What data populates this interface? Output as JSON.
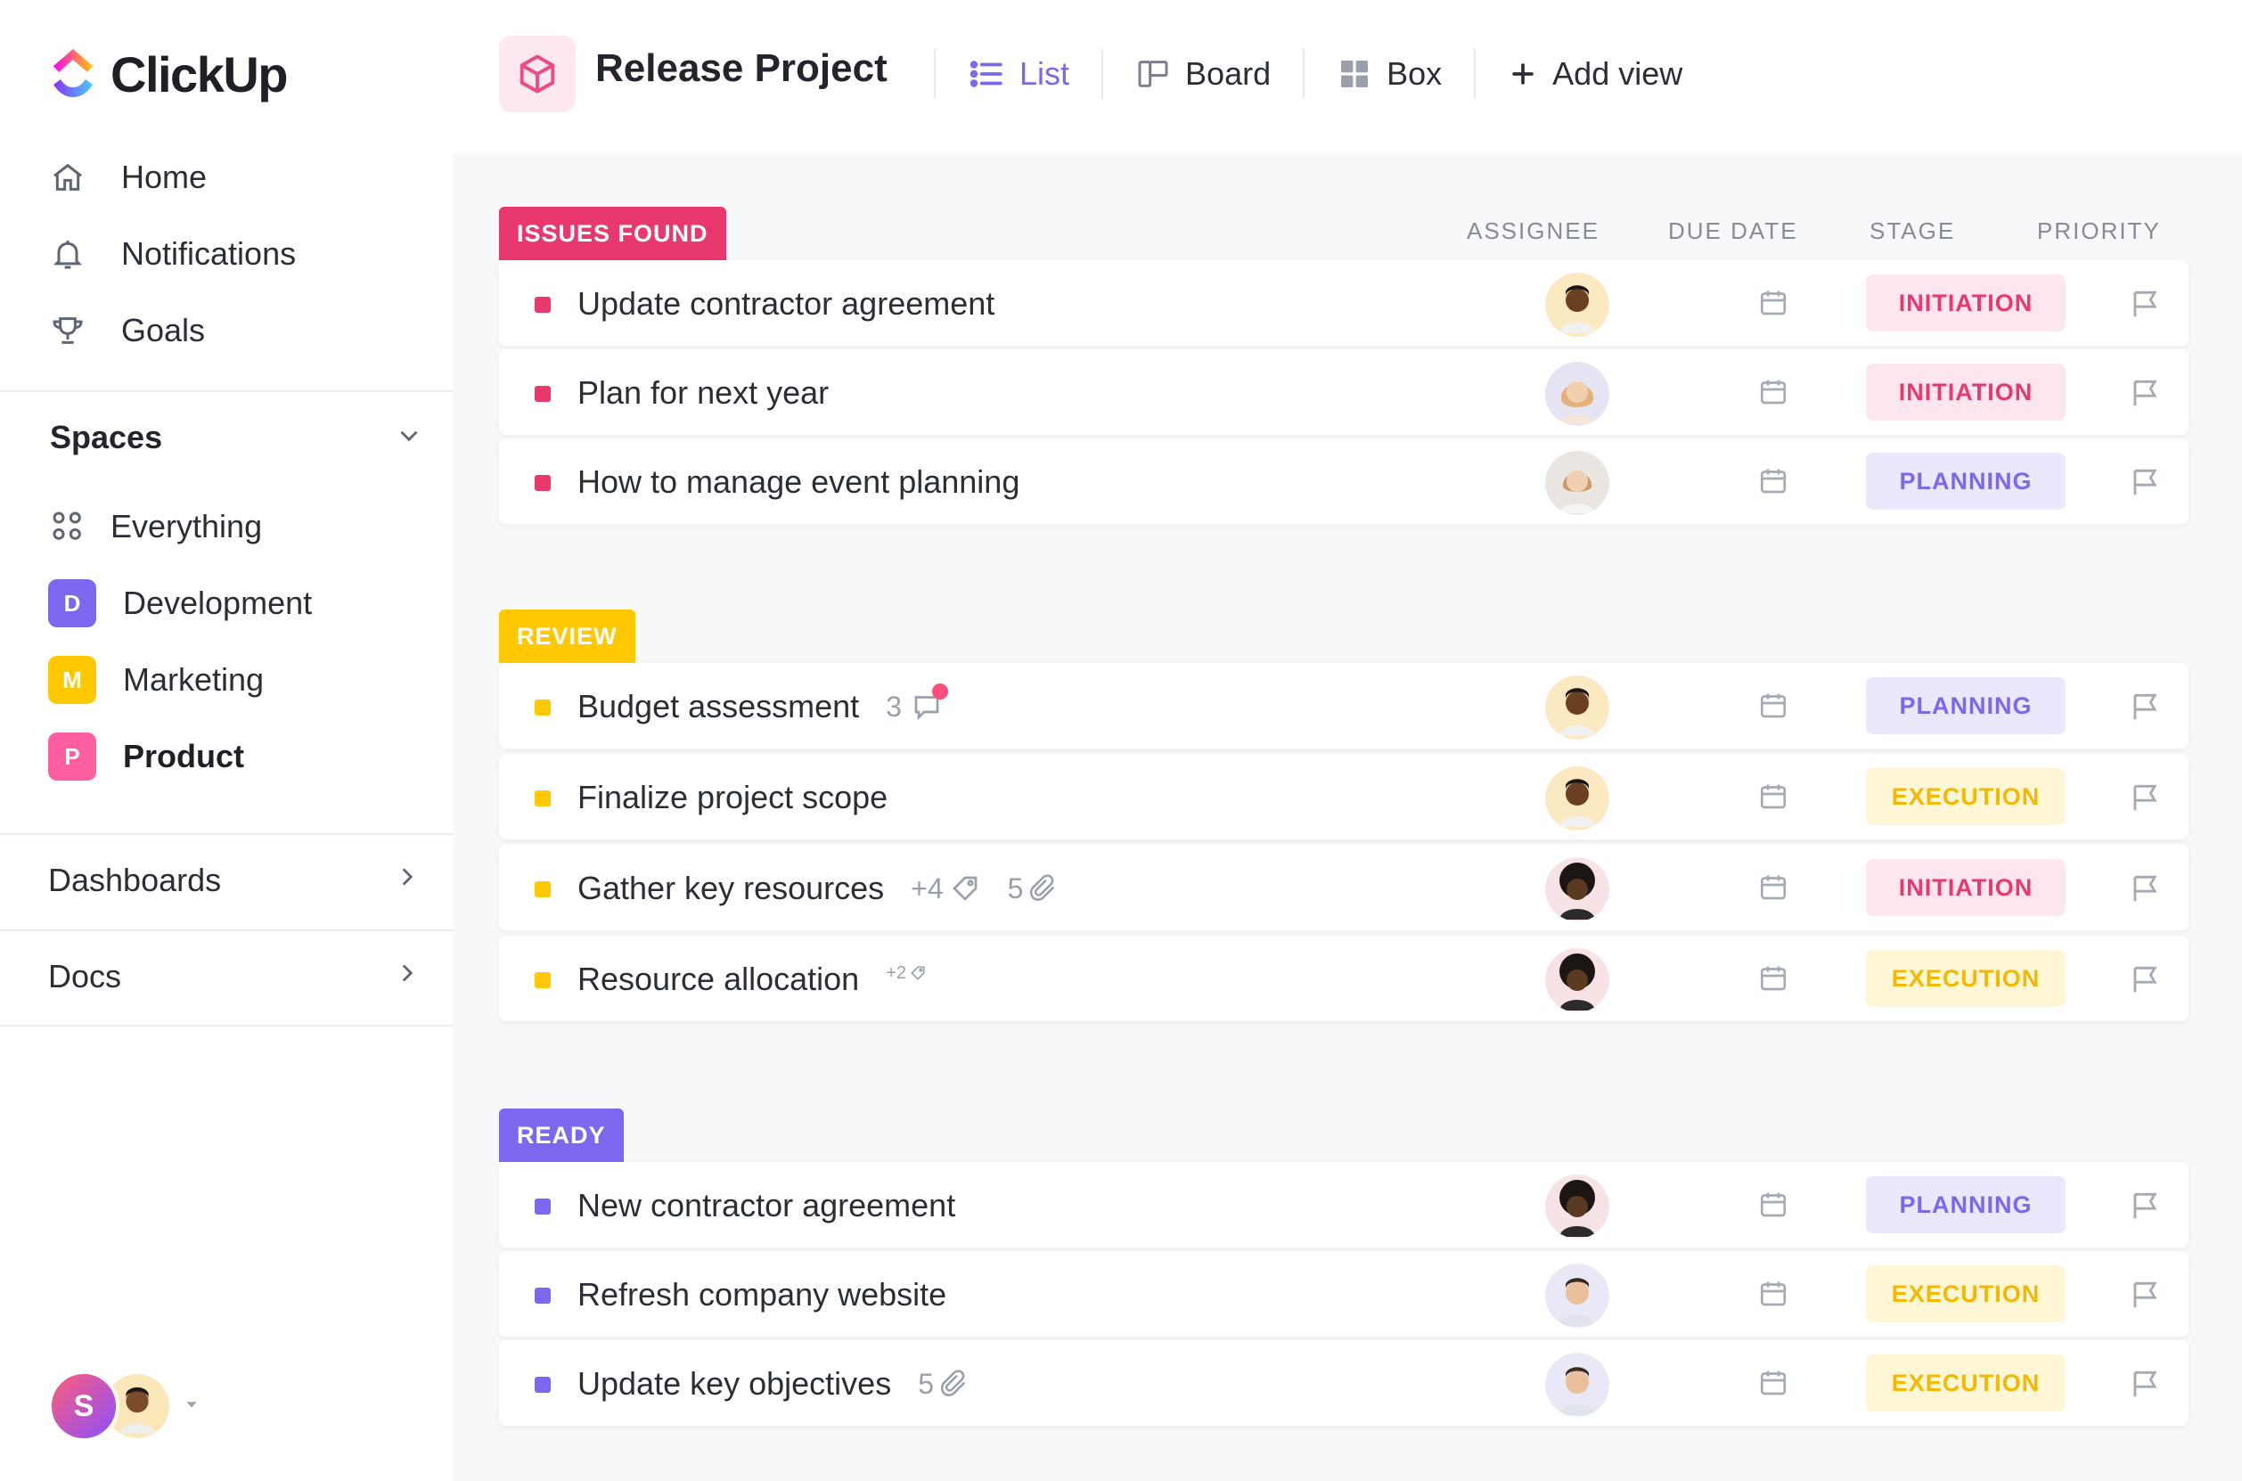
{
  "app": {
    "brand": "ClickUp"
  },
  "sidebar": {
    "nav": [
      {
        "label": "Home",
        "icon": "home-icon"
      },
      {
        "label": "Notifications",
        "icon": "bell-icon"
      },
      {
        "label": "Goals",
        "icon": "trophy-icon"
      }
    ],
    "spaces_title": "Spaces",
    "spaces": [
      {
        "label": "Everything",
        "icon": "grid-icon"
      },
      {
        "label": "Development",
        "badge": "D",
        "color": "#7b68ee"
      },
      {
        "label": "Marketing",
        "badge": "M",
        "color": "#ffc800"
      },
      {
        "label": "Product",
        "badge": "P",
        "color": "#ff5fa0"
      }
    ],
    "dashboards": "Dashboards",
    "docs": "Docs",
    "user_initial": "S"
  },
  "header": {
    "project_title": "Release Project",
    "views": [
      {
        "label": "List",
        "active": true
      },
      {
        "label": "Board"
      },
      {
        "label": "Box"
      },
      {
        "label": "Add view"
      }
    ]
  },
  "columns": {
    "assignee": "ASSIGNEE",
    "due_date": "DUE DATE",
    "stage": "STAGE",
    "priority": "PRIORITY"
  },
  "groups": [
    {
      "label": "ISSUES FOUND",
      "color": "#e8386d",
      "tasks": [
        {
          "name": "Update contractor agreement",
          "stage": "INITIATION"
        },
        {
          "name": "Plan for next year",
          "stage": "INITIATION"
        },
        {
          "name": "How to manage event planning",
          "stage": "PLANNING"
        }
      ]
    },
    {
      "label": "REVIEW",
      "color": "#ffc800",
      "tasks": [
        {
          "name": "Budget assessment",
          "stage": "PLANNING",
          "comments": "3"
        },
        {
          "name": "Finalize project scope",
          "stage": "EXECUTION"
        },
        {
          "name": "Gather key resources",
          "stage": "INITIATION",
          "tags": "+4",
          "attachments": "5"
        },
        {
          "name": "Resource allocation",
          "stage": "EXECUTION",
          "tags_small": "+2"
        }
      ]
    },
    {
      "label": "READY",
      "color": "#7b68ee",
      "tasks": [
        {
          "name": "New contractor agreement",
          "stage": "PLANNING"
        },
        {
          "name": "Refresh company website",
          "stage": "EXECUTION"
        },
        {
          "name": "Update key objectives",
          "stage": "EXECUTION",
          "attachments": "5"
        }
      ]
    }
  ],
  "stage_colors": {
    "INITIATION": {
      "bg": "#fde6ee",
      "fg": "#e8386d"
    },
    "PLANNING": {
      "bg": "#eae8fd",
      "fg": "#7b68ee"
    },
    "EXECUTION": {
      "bg": "#fff6d6",
      "fg": "#f5b800"
    }
  }
}
